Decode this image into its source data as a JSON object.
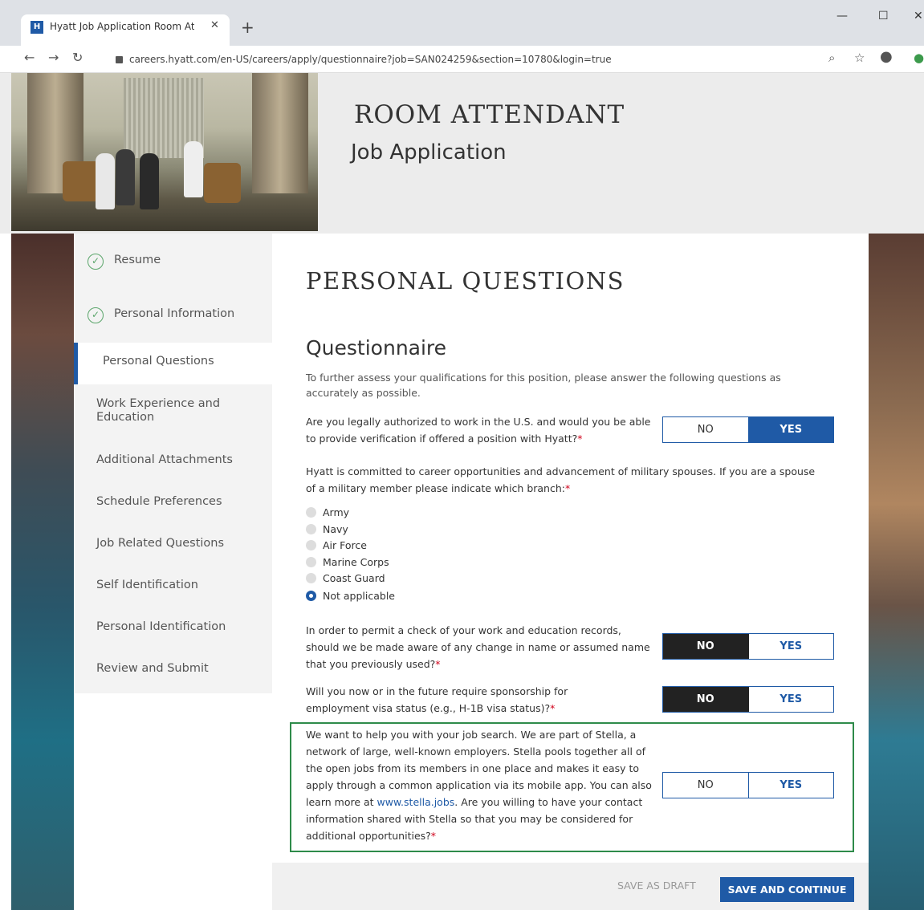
{
  "browser": {
    "tab_title": "Hyatt Job Application Room Atte",
    "favicon": "H",
    "url": "careers.hyatt.com/en-US/careers/apply/questionnaire?job=SAN024259&section=10780&login=true"
  },
  "header": {
    "job_title": "ROOM ATTENDANT",
    "job_subtitle": "Job Application"
  },
  "sidebar": {
    "items": [
      {
        "label": "Resume",
        "state": "complete"
      },
      {
        "label": "Personal Information",
        "state": "complete"
      },
      {
        "label": "Personal Questions",
        "state": "active"
      },
      {
        "label": "Work Experience and Education",
        "state": "pending"
      },
      {
        "label": "Additional Attachments",
        "state": "pending"
      },
      {
        "label": "Schedule Preferences",
        "state": "pending"
      },
      {
        "label": "Job Related Questions",
        "state": "pending"
      },
      {
        "label": "Self Identification",
        "state": "pending"
      },
      {
        "label": "Personal Identification",
        "state": "pending"
      },
      {
        "label": "Review and Submit",
        "state": "pending"
      }
    ]
  },
  "main": {
    "page_heading": "PERSONAL QUESTIONS",
    "section_heading": "Questionnaire",
    "intro": "To further assess your qualifications for this position, please answer the following questions as accurately as possible.",
    "required_mark": "*",
    "no_label": "NO",
    "yes_label": "YES",
    "q1": {
      "text": "Are you legally authorized to work in the U.S. and would you be able to provide verification if offered a position with Hyatt?",
      "answer": "YES"
    },
    "q2": {
      "text": "Hyatt is committed to career opportunities and advancement of military spouses.  If you are a spouse of a military member please indicate which branch:",
      "options": [
        "Army",
        "Navy",
        "Air Force",
        "Marine Corps",
        "Coast Guard",
        "Not applicable"
      ],
      "selected": "Not applicable"
    },
    "q3": {
      "text": "In order to permit a check of your work and education records, should we be made aware of any change in name or assumed name that you previously used?",
      "answer": "NO"
    },
    "q4": {
      "text": "Will you now or in the future require sponsorship for employment visa status (e.g., H-1B visa status)?",
      "answer": "NO"
    },
    "q5": {
      "text_before_link": "We want to help you with your job search. We are part of Stella, a network of large, well-known employers. Stella pools together all of the open jobs from its members in one place and makes it easy to apply through a common application via its mobile app. You can also learn more at ",
      "link_text": "www.stella.jobs",
      "text_after_link": ". Are you willing to have your contact information shared with Stella so that you may be considered for additional opportunities?",
      "answer": ""
    },
    "save_draft_label": "SAVE AS DRAFT",
    "save_continue_label": "SAVE AND CONTINUE"
  },
  "colors": {
    "accent": "#1f5aa6",
    "highlight_border": "#2e8b4a",
    "required": "#d0021b"
  }
}
